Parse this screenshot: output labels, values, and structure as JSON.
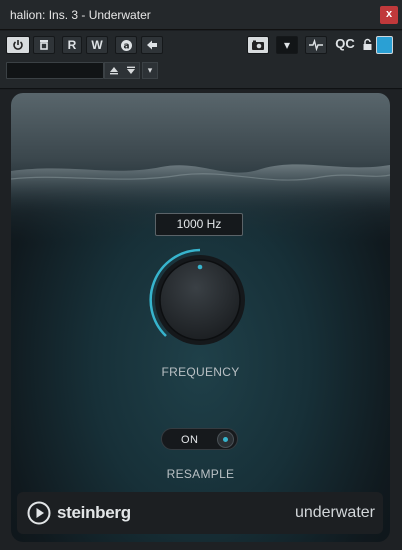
{
  "window": {
    "title": "halion: Ins. 3 - Underwater",
    "close_label": "x"
  },
  "toolbar": {
    "read_label": "R",
    "write_label": "W",
    "auto_label": "a",
    "qc_label": "QC",
    "dropdown_arrow": "▾"
  },
  "preset": {
    "value": ""
  },
  "plugin": {
    "frequency_value": "1000 Hz",
    "frequency_label": "FREQUENCY",
    "frequency_level": 0.5,
    "resample_state": "ON",
    "resample_label": "RESAMPLE",
    "brand": "steinberg",
    "product": "underwater",
    "accent_color": "#37b4cd"
  }
}
